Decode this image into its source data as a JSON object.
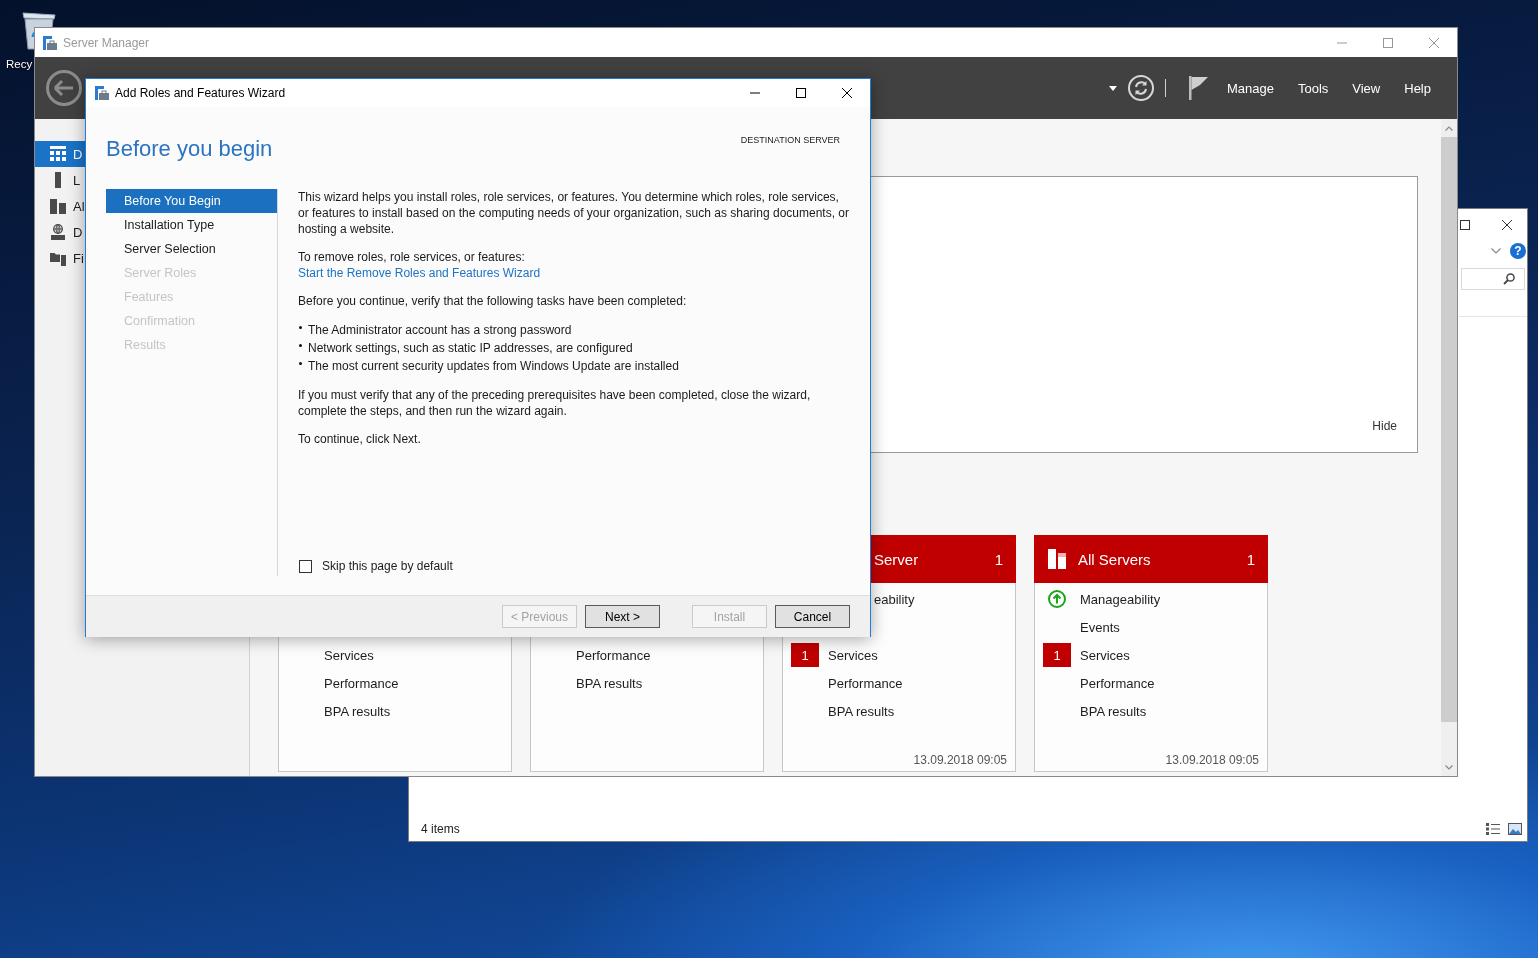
{
  "desktop": {
    "icons": [
      {
        "label": "Recy"
      }
    ]
  },
  "explorer_window": {
    "help_glyph": "?",
    "status_bar": "4 items"
  },
  "server_manager": {
    "title": "Server Manager",
    "menu": [
      "Manage",
      "Tools",
      "View",
      "Help"
    ],
    "nav_items": [
      {
        "label": "D",
        "selected": true
      },
      {
        "label": "L",
        "selected": false
      },
      {
        "label": "Al",
        "selected": false
      },
      {
        "label": "D",
        "selected": false
      },
      {
        "label": "Fi",
        "selected": false
      }
    ],
    "welcome_panel": {
      "hide_link": "Hide"
    },
    "tiles": [
      {
        "rows": [
          {
            "label": "Services"
          },
          {
            "label": "Performance"
          },
          {
            "label": "BPA results"
          }
        ]
      },
      {
        "rows": [
          {
            "label": "Performance"
          },
          {
            "label": "BPA results"
          }
        ]
      },
      {
        "title": "Server",
        "count": "1",
        "alert": true,
        "rows": [
          {
            "label": "eability"
          },
          {
            "label": "Services",
            "badge": "1"
          },
          {
            "label": "Performance"
          },
          {
            "label": "BPA results"
          }
        ],
        "timestamp": "13.09.2018 09:05"
      },
      {
        "title": "All Servers",
        "count": "1",
        "alert": true,
        "rows": [
          {
            "label": "Manageability",
            "online": true
          },
          {
            "label": "Events"
          },
          {
            "label": "Services",
            "badge": "1"
          },
          {
            "label": "Performance"
          },
          {
            "label": "BPA results"
          }
        ],
        "timestamp": "13.09.2018 09:05"
      }
    ]
  },
  "wizard": {
    "title": "Add Roles and Features Wizard",
    "heading": "Before you begin",
    "destination_label": "DESTINATION SERVER",
    "steps": [
      {
        "label": "Before You Begin",
        "selected": true,
        "disabled": false
      },
      {
        "label": "Installation Type",
        "selected": false,
        "disabled": false
      },
      {
        "label": "Server Selection",
        "selected": false,
        "disabled": false
      },
      {
        "label": "Server Roles",
        "selected": false,
        "disabled": true
      },
      {
        "label": "Features",
        "selected": false,
        "disabled": true
      },
      {
        "label": "Confirmation",
        "selected": false,
        "disabled": true
      },
      {
        "label": "Results",
        "selected": false,
        "disabled": true
      }
    ],
    "content": [
      {
        "kind": "paragraph",
        "text": "This wizard helps you install roles, role services, or features. You determine which roles, role services, or features to install based on the computing needs of your organization, such as sharing documents, or hosting a website."
      },
      {
        "kind": "paragraph",
        "text": "To remove roles, role services, or features:",
        "link": "Start the Remove Roles and Features Wizard"
      },
      {
        "kind": "paragraph",
        "text": "Before you continue, verify that the following tasks have been completed:"
      },
      {
        "kind": "bullets",
        "items": [
          "The Administrator account has a strong password",
          "Network settings, such as static IP addresses, are configured",
          "The most current security updates from Windows Update are installed"
        ]
      },
      {
        "kind": "paragraph",
        "text": "If you must verify that any of the preceding prerequisites have been completed, close the wizard, complete the steps, and then run the wizard again."
      },
      {
        "kind": "paragraph",
        "text": "To continue, click Next."
      }
    ],
    "skip_checkbox": {
      "label": "Skip this page by default",
      "checked": false
    },
    "buttons": [
      {
        "label": "< Previous",
        "disabled": true
      },
      {
        "label": "Next >",
        "disabled": false
      },
      {
        "label": "Install",
        "disabled": true
      },
      {
        "label": "Cancel",
        "disabled": false
      }
    ]
  }
}
